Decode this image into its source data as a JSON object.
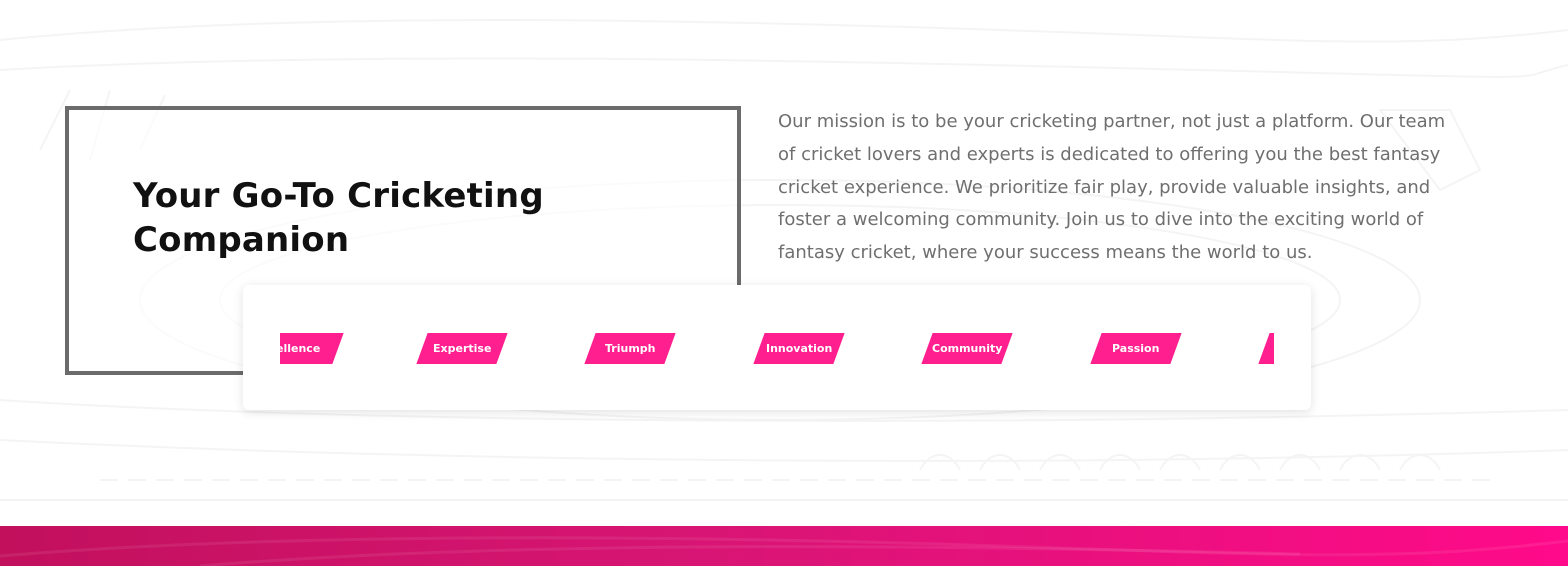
{
  "section": {
    "heading": "Your Go-To Cricketing Companion",
    "mission_text": "Our mission is to be your cricketing partner, not just a platform. Our team of cricket lovers and experts is dedicated to offering you the best fantasy cricket experience. We prioritize fair play, provide valuable insights, and foster a welcoming community. Join us to dive into the exciting world of fantasy cricket, where your success means the world to us."
  },
  "ticker": {
    "tags": [
      {
        "label": "ellence"
      },
      {
        "label": "Expertise"
      },
      {
        "label": "Triumph"
      },
      {
        "label": "Innovation"
      },
      {
        "label": "Community"
      },
      {
        "label": "Passion"
      },
      {
        "label": ""
      }
    ]
  },
  "colors": {
    "accent": "#ff1f8e",
    "frame_border": "#6b6b6b",
    "heading": "#111111",
    "body_text": "#6f6f6f",
    "footer_start": "#c2105d",
    "footer_end": "#ff0a8a"
  }
}
